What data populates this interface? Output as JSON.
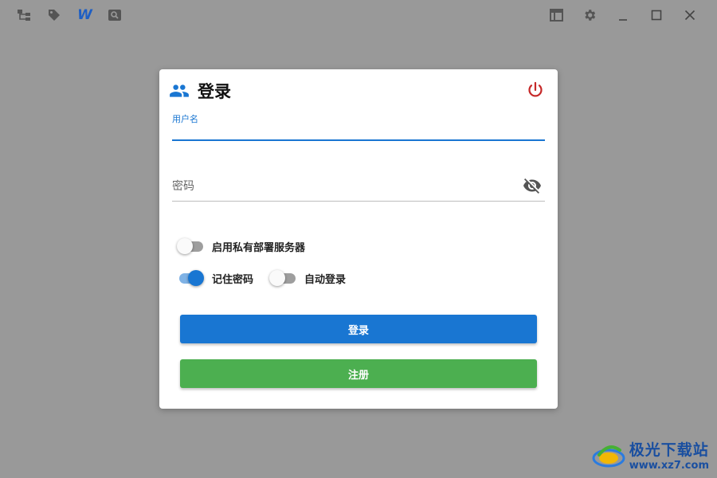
{
  "toolbar": {
    "left_icons": [
      "tree-icon",
      "tag-icon",
      "w-logo-icon",
      "search-image-icon"
    ],
    "w_logo_text": "W",
    "right_icons": [
      "layout-icon",
      "gear-icon",
      "minimize-icon",
      "maximize-icon",
      "close-icon"
    ]
  },
  "dialog": {
    "title": "登录",
    "username": {
      "label": "用户名",
      "value": ""
    },
    "password": {
      "placeholder": "密码",
      "value": ""
    },
    "switches": [
      {
        "label": "启用私有部署服务器",
        "on": false
      },
      {
        "label": "记住密码",
        "on": true
      },
      {
        "label": "自动登录",
        "on": false
      }
    ],
    "login_button": "登录",
    "register_button": "注册"
  },
  "watermark": {
    "name": "极光下载站",
    "url": "www.xz7.com"
  },
  "colors": {
    "background": "#999999",
    "primary": "#1976d2",
    "success": "#4caf50",
    "power": "#c62828"
  }
}
